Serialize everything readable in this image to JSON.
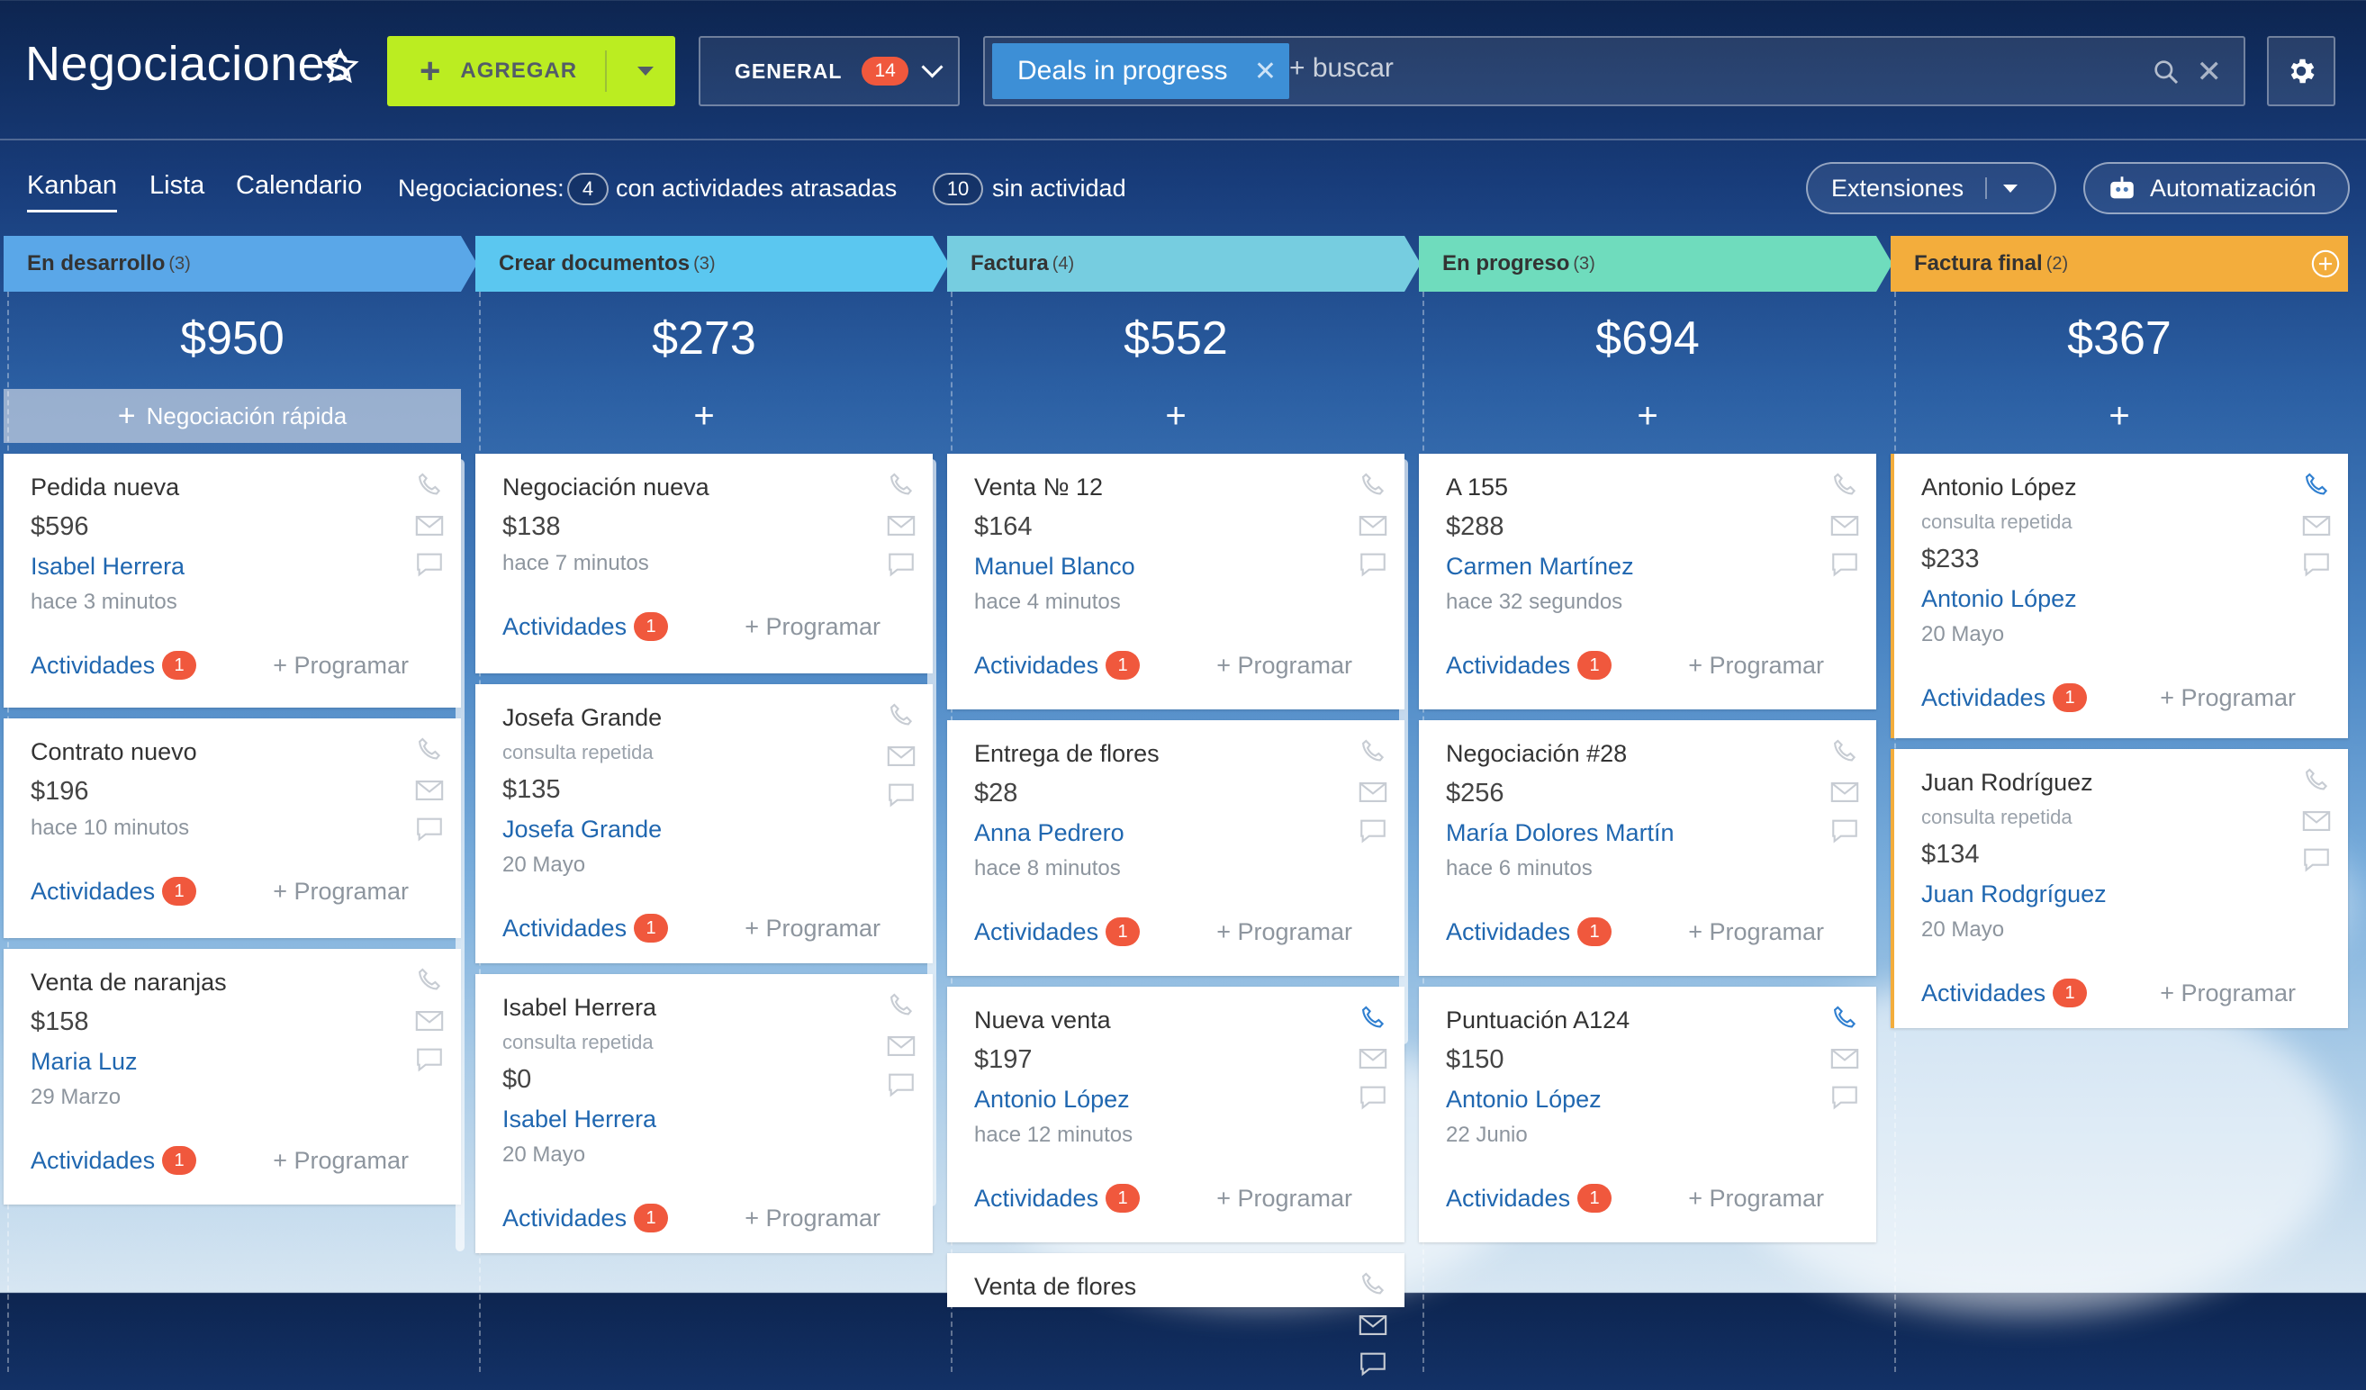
{
  "header": {
    "title": "Negociaciones",
    "add_label": "AGREGAR",
    "general_label": "GENERAL",
    "general_count": "14",
    "filter_chip": "Deals in progress",
    "search_placeholder": "+ buscar"
  },
  "tabs": [
    "Kanban",
    "Lista",
    "Calendario"
  ],
  "stats": {
    "label": "Negociaciones:",
    "overdue_count": "4",
    "overdue_text": "con actividades atrasadas",
    "idle_count": "10",
    "idle_text": "sin actividad"
  },
  "buttons": {
    "extensions": "Extensiones",
    "automation": "Automatización"
  },
  "common": {
    "activities": "Actividades",
    "schedule": "+ Programar",
    "quick_deal": "Negociación rápida",
    "plus": "+"
  },
  "colors": {
    "en_desarrollo": "#5aa7e8",
    "crear_documentos": "#5bc7f0",
    "factura": "#76cde0",
    "en_progreso": "#6fdcbd",
    "factura_final": "#f3ad3c"
  },
  "columns": [
    {
      "name": "En desarrollo",
      "count": "(3)",
      "total": "$950",
      "cards": [
        {
          "title": "Pedida nueva",
          "price": "$596",
          "contact": "Isabel Herrera",
          "when": "hace 3 minutos",
          "badge": "1"
        },
        {
          "title": "Contrato nuevo",
          "price": "$196",
          "when": "hace 10 minutos",
          "badge": "1"
        },
        {
          "title": "Venta de naranjas",
          "price": "$158",
          "contact": "Maria Luz",
          "when": "29 Marzo",
          "badge": "1"
        }
      ]
    },
    {
      "name": "Crear documentos",
      "count": "(3)",
      "total": "$273",
      "cards": [
        {
          "title": "Negociación nueva",
          "price": "$138",
          "when": "hace 7 minutos",
          "badge": "1"
        },
        {
          "title": "Josefa Grande",
          "sub": "consulta repetida",
          "price": "$135",
          "contact": "Josefa Grande",
          "when": "20 Mayo",
          "badge": "1"
        },
        {
          "title": "Isabel Herrera",
          "sub": "consulta repetida",
          "price": "$0",
          "contact": "Isabel Herrera",
          "when": "20 Mayo",
          "badge": "1"
        }
      ]
    },
    {
      "name": "Factura",
      "count": "(4)",
      "total": "$552",
      "cards": [
        {
          "title": "Venta № 12",
          "price": "$164",
          "contact": "Manuel Blanco",
          "when": "hace 4 minutos",
          "badge": "1"
        },
        {
          "title": "Entrega de flores",
          "price": "$28",
          "contact": "Anna Pedrero",
          "when": "hace 8 minutos",
          "badge": "1"
        },
        {
          "title": "Nueva venta",
          "price": "$197",
          "contact": "Antonio López",
          "when": "hace 12 minutos",
          "badge": "1"
        },
        {
          "title": "Venta de flores"
        }
      ]
    },
    {
      "name": "En progreso",
      "count": "(3)",
      "total": "$694",
      "cards": [
        {
          "title": "A 155",
          "price": "$288",
          "contact": "Carmen Martínez",
          "when": "hace 32 segundos",
          "badge": "1"
        },
        {
          "title": "Negociación #28",
          "price": "$256",
          "contact": "María Dolores Martín",
          "when": "hace 6 minutos",
          "badge": "1"
        },
        {
          "title": "Puntuación A124",
          "price": "$150",
          "contact": "Antonio López",
          "when": "22 Junio",
          "badge": "1"
        }
      ]
    },
    {
      "name": "Factura final",
      "count": "(2)",
      "total": "$367",
      "cards": [
        {
          "title": "Antonio López",
          "sub": "consulta repetida",
          "price": "$233",
          "contact": "Antonio López",
          "when": "20 Mayo",
          "badge": "1"
        },
        {
          "title": "Juan Rodríguez",
          "sub": "consulta repetida",
          "price": "$134",
          "contact": "Juan Rodgríguez",
          "when": "20 Mayo",
          "badge": "1"
        }
      ]
    }
  ]
}
